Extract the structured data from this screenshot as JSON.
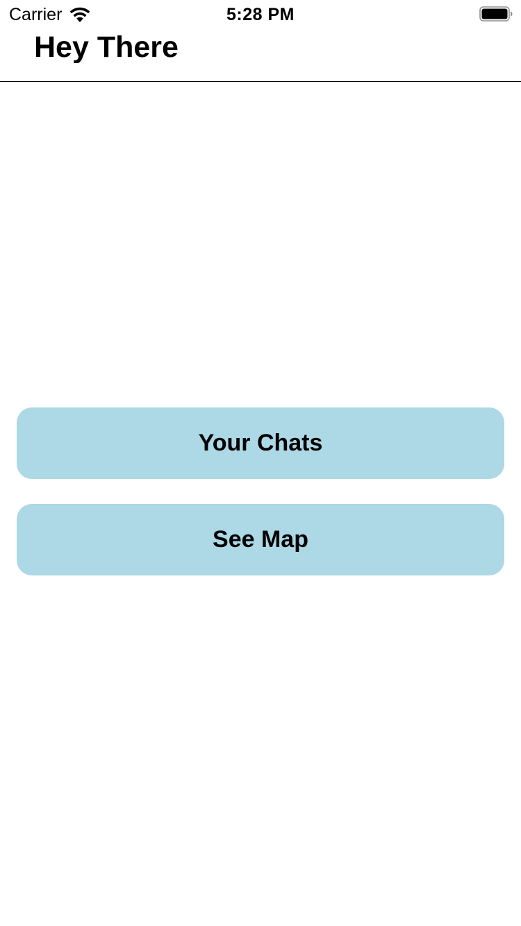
{
  "status_bar": {
    "carrier": "Carrier",
    "time": "5:28 PM",
    "wifi_icon": "wifi-icon",
    "battery_icon": "battery-full-icon"
  },
  "header": {
    "title": "Hey There"
  },
  "buttons": {
    "chats_label": "Your Chats",
    "map_label": "See Map"
  },
  "colors": {
    "button_background": "#ADD8E6",
    "page_background": "#FFFFFF",
    "text": "#000000"
  }
}
